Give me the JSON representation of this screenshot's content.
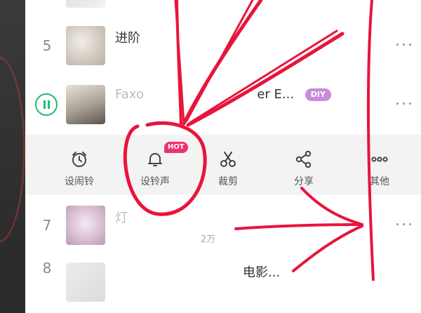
{
  "rows": [
    {
      "rank": "5",
      "title": "进阶",
      "subtitle": "",
      "more": "···"
    },
    {
      "rank": "",
      "title": "Faxo",
      "title_tail": "er E...",
      "badge": "DIY",
      "subtitle": "",
      "more": "···"
    },
    {
      "rank": "7",
      "title": "灯",
      "subtitle": "2万",
      "more": "···"
    },
    {
      "rank": "8",
      "title": "电影...",
      "subtitle": "",
      "more": ""
    }
  ],
  "actions": [
    {
      "label": "设闹铃",
      "icon": "alarm-clock-icon"
    },
    {
      "label": "设铃声",
      "icon": "bell-icon",
      "badge": "HOT"
    },
    {
      "label": "裁剪",
      "icon": "scissors-icon"
    },
    {
      "label": "分享",
      "icon": "share-icon"
    },
    {
      "label": "其他",
      "icon": "more-dots-icon"
    }
  ],
  "colors": {
    "accent_green": "#1fba78",
    "hot_badge": "#f0306a",
    "diy_badge": "#c98ad9",
    "annotation_red": "#e8143c"
  }
}
